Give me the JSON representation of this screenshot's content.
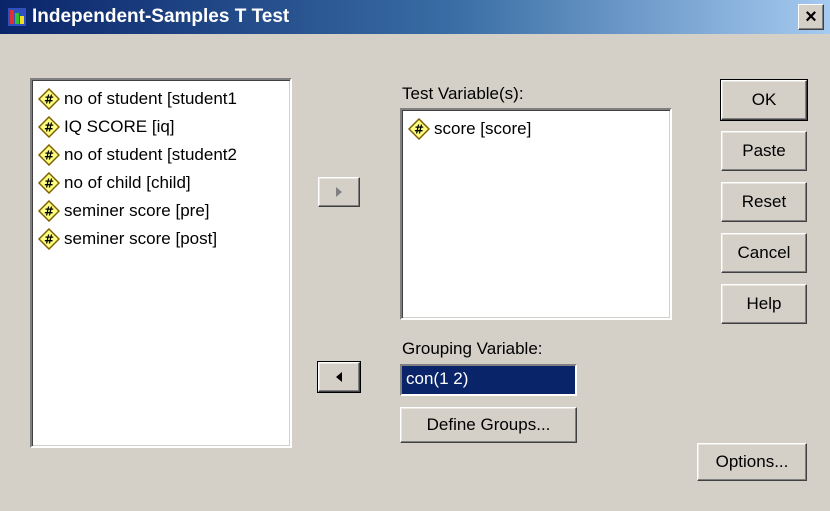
{
  "window": {
    "title": "Independent-Samples T Test",
    "close_label": "×"
  },
  "source_list": {
    "items": [
      "no of student [student1",
      "IQ SCORE [iq]",
      "no of student [student2",
      "no of child [child]",
      "seminer score [pre]",
      "seminer score [post]"
    ]
  },
  "test_variables": {
    "label": "Test Variable(s):",
    "items": [
      "score [score]"
    ]
  },
  "grouping": {
    "label": "Grouping Variable:",
    "value": "con(1 2)",
    "define_groups_label": "Define Groups..."
  },
  "buttons": {
    "ok": "OK",
    "paste": "Paste",
    "reset": "Reset",
    "cancel": "Cancel",
    "help": "Help",
    "options": "Options..."
  },
  "icons": {
    "variable": "numeric-variable-icon",
    "move_right": "arrow-right-icon",
    "move_left": "arrow-left-icon",
    "app": "spss-app-icon"
  },
  "colors": {
    "dialog_bg": "#d4d0c8",
    "title_dark": "#0a246a",
    "title_light": "#a6caf0",
    "selection": "#0a246a",
    "icon_fill": "#ffff80"
  }
}
